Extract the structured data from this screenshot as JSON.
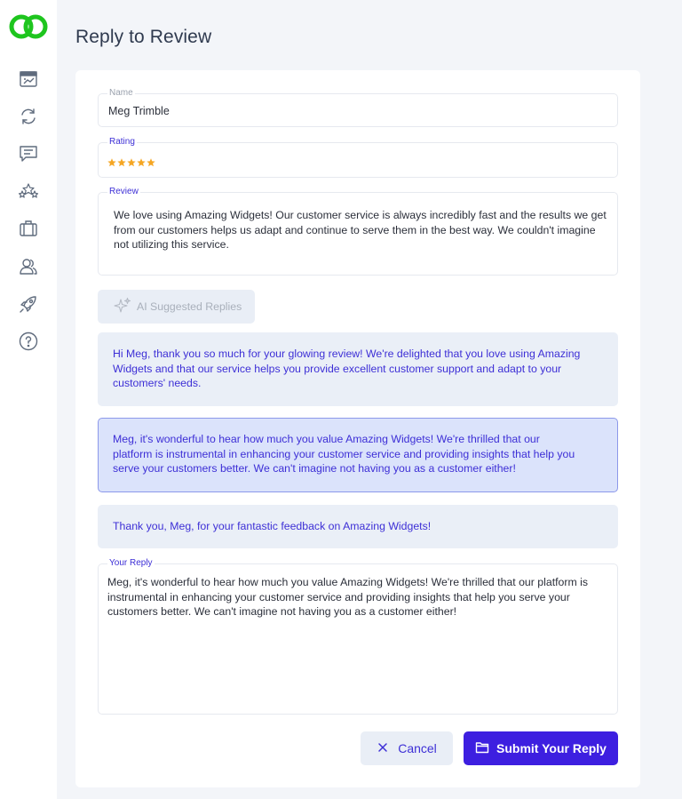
{
  "page": {
    "title": "Reply to Review"
  },
  "sidebar": {
    "items": [
      {
        "icon": "dashboard-icon"
      },
      {
        "icon": "sync-icon"
      },
      {
        "icon": "chat-icon"
      },
      {
        "icon": "stars-icon"
      },
      {
        "icon": "briefcase-icon"
      },
      {
        "icon": "users-icon"
      },
      {
        "icon": "rocket-icon"
      },
      {
        "icon": "help-icon"
      }
    ]
  },
  "form": {
    "name": {
      "label": "Name",
      "value": "Meg Trimble"
    },
    "rating": {
      "label": "Rating",
      "value": 5,
      "max": 5
    },
    "review": {
      "label": "Review",
      "text": "We love using Amazing Widgets! Our customer service is always incredibly fast and the results we get from our customers helps us adapt and continue to serve them in the best way. We couldn't imagine not utilizing this service."
    },
    "ai_button_label": "AI Suggested Replies",
    "suggestions": [
      {
        "text": "Hi Meg, thank you so much for your glowing review! We're delighted that you love using Amazing Widgets and that our service helps you provide excellent customer support and adapt to your customers' needs.",
        "selected": false
      },
      {
        "text": "Meg, it's wonderful to hear how much you value Amazing Widgets! We're thrilled that our platform is instrumental in enhancing your customer service and providing insights that help you serve your customers better. We can't imagine not having you as a customer either!",
        "selected": true
      },
      {
        "text": "Thank you, Meg, for your fantastic feedback on Amazing Widgets!",
        "selected": false
      }
    ],
    "reply": {
      "label": "Your Reply",
      "text": "Meg, it's wonderful to hear how much you value Amazing Widgets! We're thrilled that our platform is instrumental in enhancing your customer service and providing insights that help you serve your customers better. We can't imagine not having you as a customer either!"
    },
    "cancel_label": "Cancel",
    "submit_label": "Submit Your Reply"
  },
  "colors": {
    "accent": "#3d1fe0",
    "brand_green": "#1ec51e",
    "star": "#f5a623",
    "selected_bg": "#dbe3fb"
  }
}
